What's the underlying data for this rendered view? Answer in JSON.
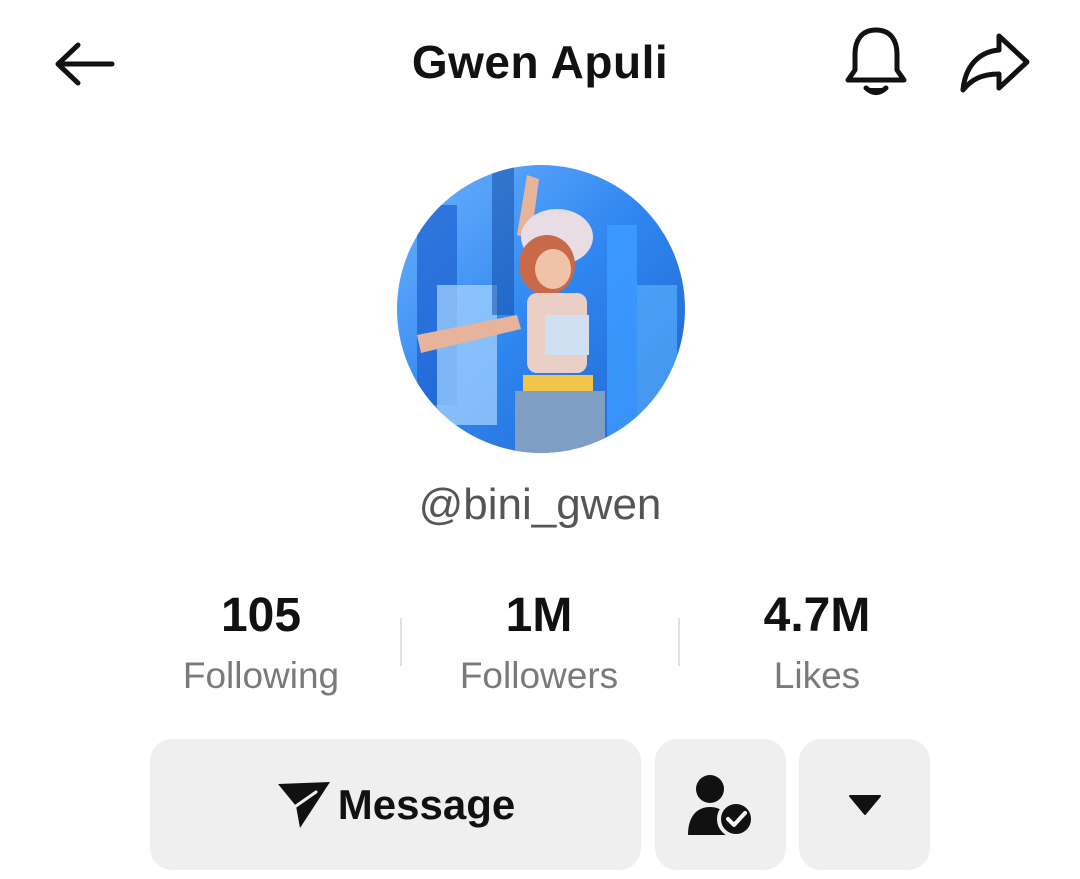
{
  "header": {
    "title": "Gwen Apuli",
    "back_icon": "arrow-left-icon",
    "notification_icon": "bell-icon",
    "share_icon": "share-arrow-icon"
  },
  "profile": {
    "avatar": "profile-photo",
    "handle": "@bini_gwen"
  },
  "stats": [
    {
      "value": "105",
      "label": "Following"
    },
    {
      "value": "1M",
      "label": "Followers"
    },
    {
      "value": "4.7M",
      "label": "Likes"
    }
  ],
  "actions": {
    "message_label": "Message",
    "message_icon": "send-icon",
    "following_icon": "user-check-icon",
    "more_icon": "caret-down-icon"
  },
  "colors": {
    "text_primary": "#111111",
    "text_secondary": "#7a7a7a",
    "handle": "#555555",
    "button_bg": "#efefef",
    "divider": "#e2e2e2"
  }
}
